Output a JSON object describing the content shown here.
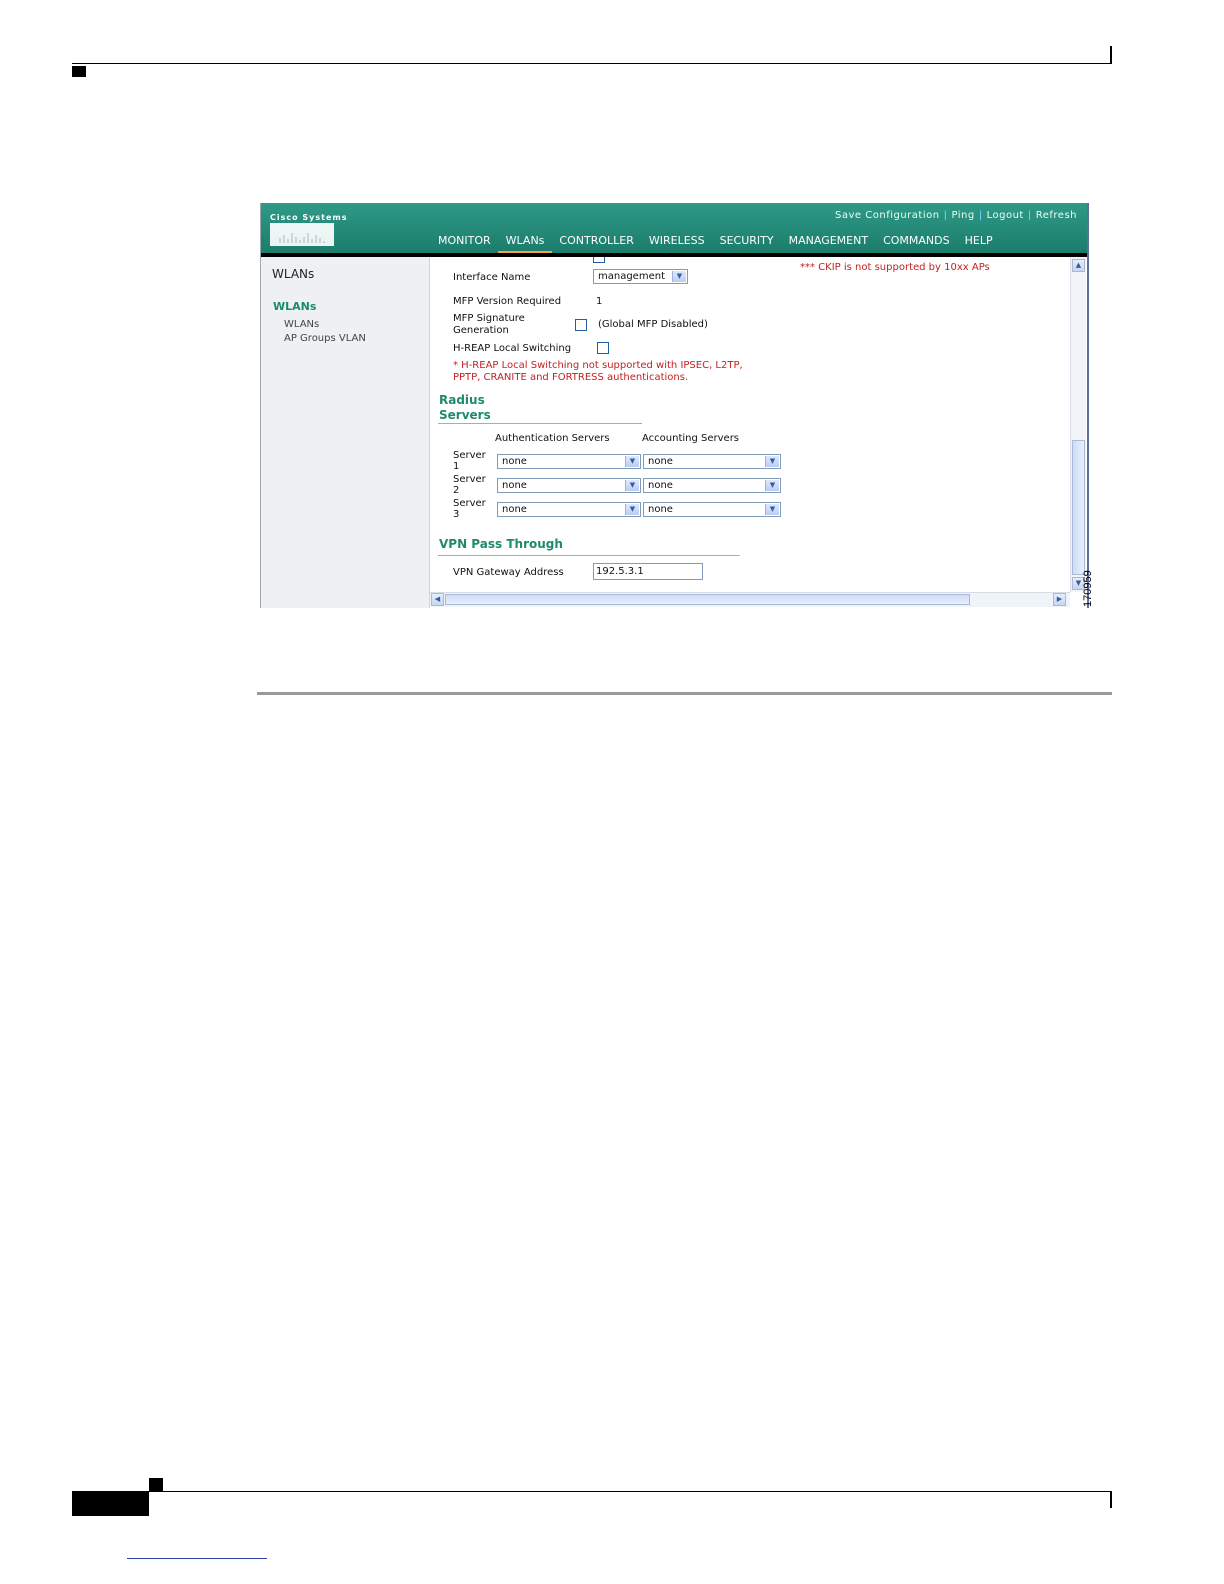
{
  "figure_id": "170959",
  "app": {
    "logo_text": "Cisco Systems",
    "utility_links": [
      "Save Configuration",
      "Ping",
      "Logout",
      "Refresh"
    ],
    "nav_tabs": [
      "MONITOR",
      "WLANs",
      "CONTROLLER",
      "WIRELESS",
      "SECURITY",
      "MANAGEMENT",
      "COMMANDS",
      "HELP"
    ],
    "active_tab": "WLANs"
  },
  "sidebar": {
    "title": "WLANs",
    "group": "WLANs",
    "items": [
      "WLANs",
      "AP Groups VLAN"
    ]
  },
  "form": {
    "ckip_note": "*** CKIP is not supported by 10xx APs",
    "interface_name_label": "Interface Name",
    "interface_name_value": "management",
    "mfp_version_label": "MFP Version Required",
    "mfp_version_value": "1",
    "mfp_signature_label_1": "MFP Signature",
    "mfp_signature_label_2": "Generation",
    "mfp_global_note": "(Global MFP Disabled)",
    "hreap_label": "H-REAP Local Switching",
    "hreap_note_1": "* H-REAP Local Switching not supported with IPSEC, L2TP,",
    "hreap_note_2": "PPTP, CRANITE and FORTRESS authentications."
  },
  "radius": {
    "title_1": "Radius",
    "title_2": "Servers",
    "auth_header": "Authentication Servers",
    "acct_header": "Accounting Servers",
    "servers": [
      {
        "label_1": "Server",
        "label_2": "1",
        "auth": "none",
        "acct": "none"
      },
      {
        "label_1": "Server",
        "label_2": "2",
        "auth": "none",
        "acct": "none"
      },
      {
        "label_1": "Server",
        "label_2": "3",
        "auth": "none",
        "acct": "none"
      }
    ]
  },
  "vpn": {
    "title": "VPN Pass Through",
    "gateway_label": "VPN Gateway Address",
    "gateway_value": "192.5.3.1"
  },
  "colors": {
    "header_green": "#1c7c6b",
    "active_tab": "#f4a43a",
    "section_green": "#1f8a6e",
    "note_red": "#c51f1f"
  }
}
